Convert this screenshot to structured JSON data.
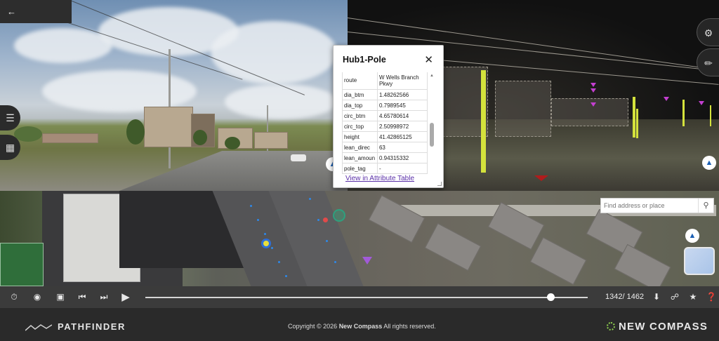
{
  "nav": {
    "back_icon": "arrow-left-icon"
  },
  "popup": {
    "title": "Hub1-Pole",
    "link": "View in Attribute Table",
    "rows": [
      {
        "key": "route",
        "value": "W Wells Branch Pkwy"
      },
      {
        "key": "dia_btm",
        "value": "1.48262566"
      },
      {
        "key": "dia_top",
        "value": "0.7989545"
      },
      {
        "key": "circ_btm",
        "value": "4.65780614"
      },
      {
        "key": "circ_top",
        "value": "2.50998972"
      },
      {
        "key": "height",
        "value": "41.42865125"
      },
      {
        "key": "lean_direc",
        "value": "63"
      },
      {
        "key": "lean_amoun",
        "value": "0.94315332"
      },
      {
        "key": "pole_tag",
        "value": "-"
      }
    ]
  },
  "map": {
    "search_placeholder": "Find address or place"
  },
  "player": {
    "frame_current": "1342",
    "frame_total": "1462",
    "counter": "1342/ 1462",
    "progress": 0.917
  },
  "footer": {
    "brand_left": "PATHFINDER",
    "copyright_prefix": "Copyright © 2026",
    "copyright_company": "New Compass",
    "copyright_suffix": "All rights reserved.",
    "brand_right": "NEW COMPASS"
  },
  "colors": {
    "pole_highlight": "#d4e23c",
    "lidar_marker": "#c33fd0",
    "link": "#5a2fa8",
    "map_route": "#2e88e8"
  }
}
